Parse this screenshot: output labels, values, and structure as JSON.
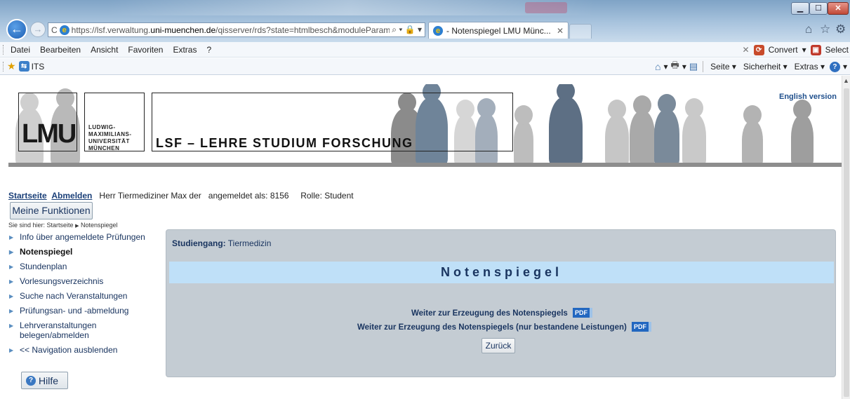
{
  "browser": {
    "url_prefix": "https://lsf.verwaltung.",
    "url_domain": "uni-muenchen.de",
    "url_rest": "/qisserver/rds?state=htmlbesch&moduleParame",
    "tab_title": "- Notenspiegel LMU Münc...",
    "menu": [
      "Datei",
      "Bearbeiten",
      "Ansicht",
      "Favoriten",
      "Extras",
      "?"
    ],
    "menu_right": {
      "convert": "Convert",
      "select": "Select"
    },
    "favorite_label": "ITS",
    "commands": {
      "seite": "Seite",
      "sicherheit": "Sicherheit",
      "extras": "Extras"
    }
  },
  "banner": {
    "logo_short": "LMU",
    "logo_lines": [
      "LUDWIG-",
      "MAXIMILIANS-",
      "UNIVERSITÄT",
      "MÜNCHEN"
    ],
    "title": "LSF – LEHRE STUDIUM FORSCHUNG",
    "english_link": "English version"
  },
  "header": {
    "startseite": "Startseite",
    "abmelden": "Abmelden",
    "user_text": "Herr Tiermediziner Max der",
    "login_text": "angemeldet als: 8156",
    "role_text": "Rolle: Student",
    "meine_funktionen": "Meine Funktionen",
    "breadcrumb_prefix": "Sie sind hier:",
    "breadcrumb_home": "Startseite",
    "breadcrumb_current": "Notenspiegel"
  },
  "sidebar": {
    "items": [
      {
        "label": "Info über angemeldete Prüfungen"
      },
      {
        "label": "Notenspiegel"
      },
      {
        "label": "Stundenplan"
      },
      {
        "label": "Vorlesungsverzeichnis"
      },
      {
        "label": "Suche nach Veranstaltungen"
      },
      {
        "label": "Prüfungsan- und -abmeldung"
      },
      {
        "label": "Lehrveranstaltungen belegen/abmelden"
      },
      {
        "label": "<< Navigation ausblenden"
      }
    ],
    "help": "Hilfe"
  },
  "main": {
    "studiengang_label": "Studiengang:",
    "studiengang_value": "Tiermedizin",
    "heading": "Notenspiegel",
    "link_all": "Weiter zur Erzeugung des Notenspiegels",
    "link_passed": "Weiter zur Erzeugung des Notenspiegels (nur bestandene Leistungen)",
    "pdf_label": "PDF",
    "back_button": "Zurück"
  }
}
